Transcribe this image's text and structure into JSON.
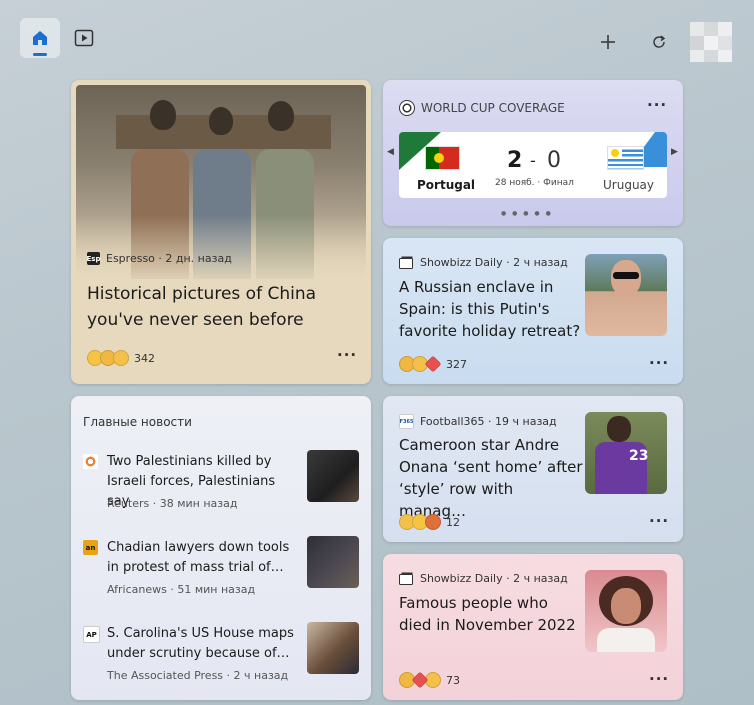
{
  "topbar": {
    "home_icon": "home-icon",
    "video_icon": "video-icon",
    "add_icon": "plus-icon",
    "refresh_icon": "refresh-icon",
    "profile_icon": "avatar"
  },
  "feature": {
    "source_badge": "Esp",
    "source": "Espresso · 2 дн. назад",
    "title_line1": "Historical pictures of China",
    "title_line2": "you've never seen before",
    "reaction_count": "342",
    "more": "···"
  },
  "worldcup": {
    "label": "WORLD CUP COVERAGE",
    "more": "···",
    "team1": "Portugal",
    "team2": "Uruguay",
    "score1": "2",
    "dash": "-",
    "score2": "0",
    "date": "28 нояб. · Финал",
    "prev": "◀",
    "next": "▶",
    "pager": "● ● ● ● ●"
  },
  "card_putin": {
    "source": "Showbizz Daily · 2 ч назад",
    "title_line1": "A Russian enclave in",
    "title_line2": "Spain: is this Putin's",
    "title_line3": "favorite holiday retreat?",
    "reaction_count": "327",
    "more": "···"
  },
  "card_onana": {
    "source_badge": "F365",
    "source": "Football365 · 19 ч назад",
    "title_line1": "Cameroon star Andre",
    "title_line2": "Onana ‘sent home’ after",
    "title_line3": "‘style’ row with manag…",
    "reaction_count": "12",
    "more": "···"
  },
  "card_famous": {
    "source": "Showbizz Daily · 2 ч назад",
    "title_line1": "Famous people who",
    "title_line2": "died in November 2022",
    "reaction_count": "73",
    "more": "···"
  },
  "topnews": {
    "heading": "Главные новости",
    "items": [
      {
        "title": "Two Palestinians killed by Israeli forces, Palestinians say",
        "meta": "Reuters · 38 мин назад",
        "badge": ""
      },
      {
        "title": "Chadian lawyers down tools in protest of mass trial of…",
        "meta": "Africanews · 51 мин назад",
        "badge": "an"
      },
      {
        "title": "S. Carolina's US House maps under scrutiny because of…",
        "meta": "The Associated Press · 2 ч назад",
        "badge": "AP"
      }
    ]
  },
  "colors": {
    "accent": "#1a6fd1",
    "portugal_red": "#d52b1e",
    "portugal_green": "#006600",
    "uruguay_blue": "#3a8fd9"
  }
}
